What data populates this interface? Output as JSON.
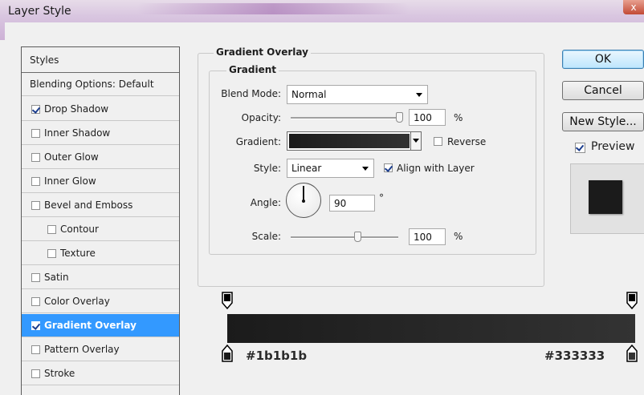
{
  "window": {
    "title": "Layer Style",
    "close_glyph": "x"
  },
  "styles_panel": {
    "header": "Styles",
    "items": [
      {
        "label": "Blending Options: Default",
        "checkbox": false,
        "checked": false,
        "indent": false,
        "selected": false,
        "header": true
      },
      {
        "label": "Drop Shadow",
        "checkbox": true,
        "checked": true,
        "indent": false,
        "selected": false
      },
      {
        "label": "Inner Shadow",
        "checkbox": true,
        "checked": false,
        "indent": false,
        "selected": false
      },
      {
        "label": "Outer Glow",
        "checkbox": true,
        "checked": false,
        "indent": false,
        "selected": false
      },
      {
        "label": "Inner Glow",
        "checkbox": true,
        "checked": false,
        "indent": false,
        "selected": false
      },
      {
        "label": "Bevel and Emboss",
        "checkbox": true,
        "checked": false,
        "indent": false,
        "selected": false
      },
      {
        "label": "Contour",
        "checkbox": true,
        "checked": false,
        "indent": true,
        "selected": false
      },
      {
        "label": "Texture",
        "checkbox": true,
        "checked": false,
        "indent": true,
        "selected": false
      },
      {
        "label": "Satin",
        "checkbox": true,
        "checked": false,
        "indent": false,
        "selected": false
      },
      {
        "label": "Color Overlay",
        "checkbox": true,
        "checked": false,
        "indent": false,
        "selected": false
      },
      {
        "label": "Gradient Overlay",
        "checkbox": true,
        "checked": true,
        "indent": false,
        "selected": true
      },
      {
        "label": "Pattern Overlay",
        "checkbox": true,
        "checked": false,
        "indent": false,
        "selected": false
      },
      {
        "label": "Stroke",
        "checkbox": true,
        "checked": false,
        "indent": false,
        "selected": false
      }
    ]
  },
  "gradient_overlay": {
    "group_title": "Gradient Overlay",
    "sub_title": "Gradient",
    "blend_mode": {
      "label": "Blend Mode:",
      "value": "Normal"
    },
    "opacity": {
      "label": "Opacity:",
      "value": "100",
      "unit": "%",
      "level": 1.0
    },
    "gradient": {
      "label": "Gradient:",
      "reverse_label": "Reverse",
      "reverse_checked": false
    },
    "style": {
      "label": "Style:",
      "value": "Linear",
      "align_label": "Align with Layer",
      "align_checked": true
    },
    "angle": {
      "label": "Angle:",
      "value": "90",
      "unit": "°"
    },
    "scale": {
      "label": "Scale:",
      "value": "100",
      "unit": "%",
      "level": 0.5
    }
  },
  "buttons": {
    "ok": "OK",
    "cancel": "Cancel",
    "new_style": "New Style...",
    "preview_label": "Preview",
    "preview_checked": true
  },
  "gradient_editor": {
    "left_color_label": "#1b1b1b",
    "right_color_label": "#333333",
    "colors": {
      "left": "#1b1b1b",
      "right": "#333333"
    }
  }
}
